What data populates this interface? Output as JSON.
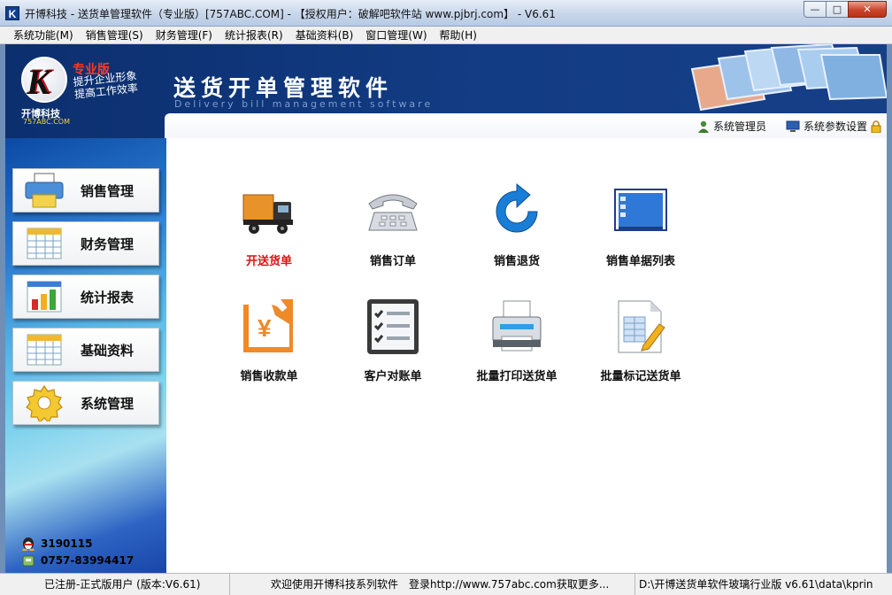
{
  "window": {
    "title": "开博科技 - 送货单管理软件（专业版）[757ABC.COM] - 【授权用户：破解吧软件站 www.pjbrj.com】 - V6.61",
    "icon_letter": "K",
    "minimize": "—",
    "maximize": "□",
    "close": "✕"
  },
  "menu": [
    "系统功能(M)",
    "销售管理(S)",
    "财务管理(F)",
    "统计报表(R)",
    "基础资料(B)",
    "窗口管理(W)",
    "帮助(H)"
  ],
  "banner": {
    "logo_letter": "K",
    "edition": "专业版",
    "slogan_1": "提升企业形象",
    "slogan_2": "提高工作效率",
    "company": "开博科技",
    "site": "757ABC.COM",
    "title": "送货开单管理软件",
    "subtitle": "Delivery bill management software",
    "user_label": "系统管理员",
    "settings_label": "系统参数设置"
  },
  "sidebar": [
    {
      "label": "销售管理",
      "icon": "printer-icon"
    },
    {
      "label": "财务管理",
      "icon": "spreadsheet-icon"
    },
    {
      "label": "统计报表",
      "icon": "bar-chart-icon"
    },
    {
      "label": "基础资料",
      "icon": "table-icon"
    },
    {
      "label": "系统管理",
      "icon": "gear-icon"
    }
  ],
  "contact": {
    "qq": "3190115",
    "phone": "0757-83994417"
  },
  "tiles": [
    {
      "label": "开送货单",
      "icon": "truck-icon",
      "active": true
    },
    {
      "label": "销售订单",
      "icon": "telephone-icon",
      "active": false
    },
    {
      "label": "销售退货",
      "icon": "refresh-arrow-icon",
      "active": false
    },
    {
      "label": "销售单据列表",
      "icon": "list-window-icon",
      "active": false
    },
    {
      "label": "销售收款单",
      "icon": "yen-receipt-icon",
      "active": false
    },
    {
      "label": "客户对账单",
      "icon": "checklist-icon",
      "active": false
    },
    {
      "label": "批量打印送货单",
      "icon": "printer-icon",
      "active": false
    },
    {
      "label": "批量标记送货单",
      "icon": "edit-sheet-icon",
      "active": false
    }
  ],
  "status": {
    "registration": "已注册-正式版用户 (版本:V6.61)",
    "welcome": "欢迎使用开博科技系列软件　登录http://www.757abc.com获取更多...",
    "path": "D:\\开博送货单软件玻璃行业版 v6.61\\data\\kprin"
  },
  "colors": {
    "banner": "#123c84",
    "accent_red": "#e01010",
    "sidebar": "#2c7bd0"
  }
}
